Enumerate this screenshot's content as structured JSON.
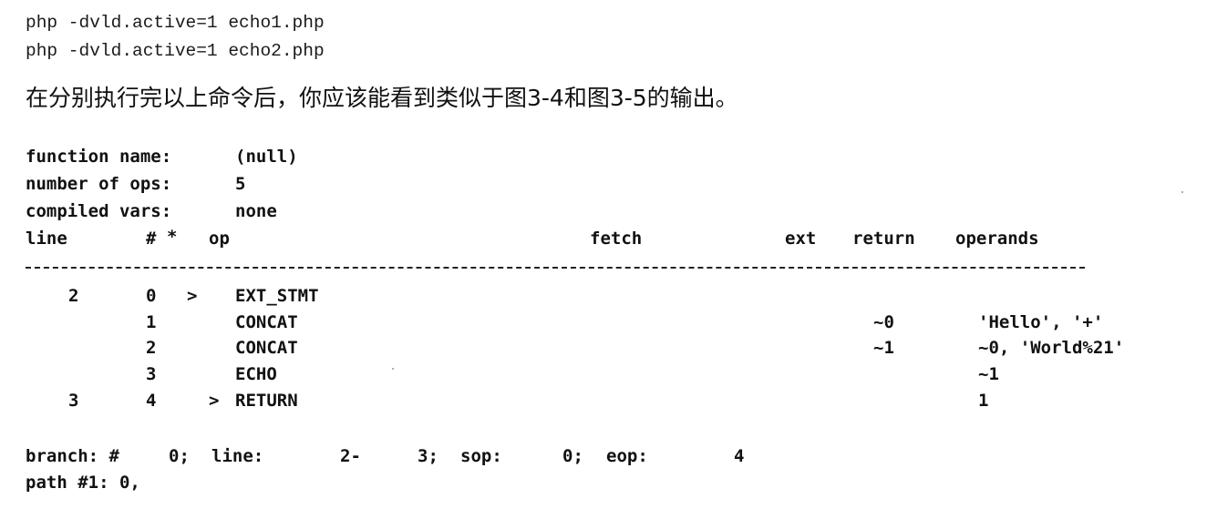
{
  "commands": [
    "php -dvld.active=1 echo1.php",
    "php -dvld.active=1 echo2.php"
  ],
  "prose": "在分别执行完以上命令后，你应该能看到类似于图3-4和图3-5的输出。",
  "header": {
    "function_name_label": "function name:",
    "function_name_value": "(null)",
    "num_ops_label": "number of ops:",
    "num_ops_value": "5",
    "compiled_vars_label": "compiled vars:",
    "compiled_vars_value": "none"
  },
  "columns": {
    "line": "line",
    "num": "#",
    "star": "*",
    "op": "op",
    "fetch": "fetch",
    "ext": "ext",
    "return": "return",
    "operands": "operands"
  },
  "rows": [
    {
      "line": "2",
      "num": "0",
      "flag": ">",
      "op": "EXT_STMT",
      "return": "",
      "operands": ""
    },
    {
      "line": "",
      "num": "1",
      "flag": "",
      "op": "CONCAT",
      "return": "~0",
      "operands": "'Hello', '+'"
    },
    {
      "line": "",
      "num": "2",
      "flag": "",
      "op": "CONCAT",
      "return": "~1",
      "operands": "~0, 'World%21'"
    },
    {
      "line": "",
      "num": "3",
      "flag": "",
      "op": "ECHO",
      "return": "",
      "operands": "~1"
    },
    {
      "line": "3",
      "num": "4",
      "flag": ">",
      "op": "RETURN",
      "return": "",
      "operands": "1"
    }
  ],
  "branch": {
    "label": "branch: #",
    "num": "0;",
    "line_label": "line:",
    "line_start": "2-",
    "line_end": "3;",
    "sop_label": "sop:",
    "sop_value": "0;",
    "eop_label": "eop:",
    "eop_value": "4"
  },
  "path": "path #1: 0,"
}
